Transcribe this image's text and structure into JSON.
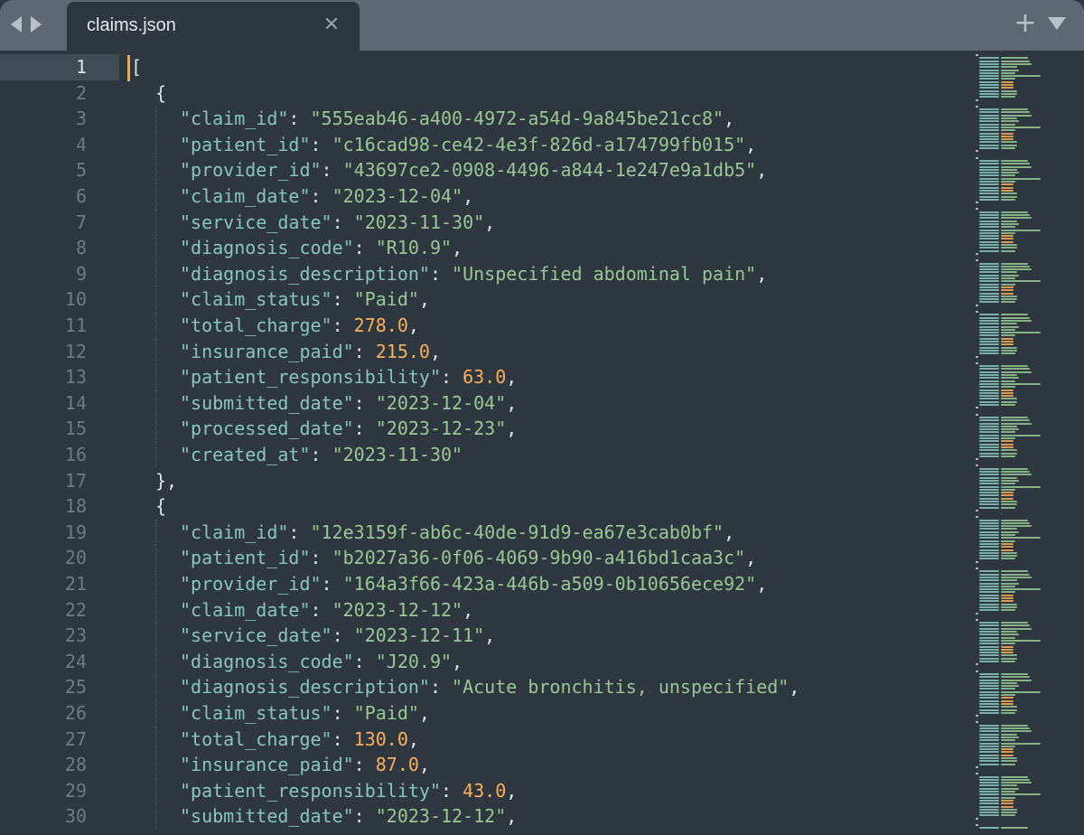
{
  "tab": {
    "title": "claims.json"
  },
  "icons": {
    "back": "triangle-left-icon",
    "forward": "triangle-right-icon",
    "close": "close-icon",
    "new_tab": "plus-icon",
    "tab_menu": "chevron-down-icon"
  },
  "colors": {
    "key": "#88c6bd",
    "string": "#99c794",
    "number": "#f9ae58",
    "punctuation": "#dfe3e7",
    "caret": "#f2a64d",
    "background": "#2e3640"
  },
  "close_glyph": "✕",
  "new_tab_glyph": "+",
  "editor": {
    "active_line": 1,
    "lines": [
      {
        "n": "1",
        "indent": 0,
        "parts": [
          {
            "t": "p",
            "v": "["
          }
        ]
      },
      {
        "n": "2",
        "indent": 1,
        "parts": [
          {
            "t": "p",
            "v": "{"
          }
        ]
      },
      {
        "n": "3",
        "indent": 2,
        "parts": [
          {
            "t": "k",
            "v": "\"claim_id\""
          },
          {
            "t": "p",
            "v": ": "
          },
          {
            "t": "s",
            "v": "\"555eab46-a400-4972-a54d-9a845be21cc8\""
          },
          {
            "t": "p",
            "v": ","
          }
        ]
      },
      {
        "n": "4",
        "indent": 2,
        "parts": [
          {
            "t": "k",
            "v": "\"patient_id\""
          },
          {
            "t": "p",
            "v": ": "
          },
          {
            "t": "s",
            "v": "\"c16cad98-ce42-4e3f-826d-a174799fb015\""
          },
          {
            "t": "p",
            "v": ","
          }
        ]
      },
      {
        "n": "5",
        "indent": 2,
        "parts": [
          {
            "t": "k",
            "v": "\"provider_id\""
          },
          {
            "t": "p",
            "v": ": "
          },
          {
            "t": "s",
            "v": "\"43697ce2-0908-4496-a844-1e247e9a1db5\""
          },
          {
            "t": "p",
            "v": ","
          }
        ]
      },
      {
        "n": "6",
        "indent": 2,
        "parts": [
          {
            "t": "k",
            "v": "\"claim_date\""
          },
          {
            "t": "p",
            "v": ": "
          },
          {
            "t": "s",
            "v": "\"2023-12-04\""
          },
          {
            "t": "p",
            "v": ","
          }
        ]
      },
      {
        "n": "7",
        "indent": 2,
        "parts": [
          {
            "t": "k",
            "v": "\"service_date\""
          },
          {
            "t": "p",
            "v": ": "
          },
          {
            "t": "s",
            "v": "\"2023-11-30\""
          },
          {
            "t": "p",
            "v": ","
          }
        ]
      },
      {
        "n": "8",
        "indent": 2,
        "parts": [
          {
            "t": "k",
            "v": "\"diagnosis_code\""
          },
          {
            "t": "p",
            "v": ": "
          },
          {
            "t": "s",
            "v": "\"R10.9\""
          },
          {
            "t": "p",
            "v": ","
          }
        ]
      },
      {
        "n": "9",
        "indent": 2,
        "parts": [
          {
            "t": "k",
            "v": "\"diagnosis_description\""
          },
          {
            "t": "p",
            "v": ": "
          },
          {
            "t": "s",
            "v": "\"Unspecified abdominal pain\""
          },
          {
            "t": "p",
            "v": ","
          }
        ]
      },
      {
        "n": "10",
        "indent": 2,
        "parts": [
          {
            "t": "k",
            "v": "\"claim_status\""
          },
          {
            "t": "p",
            "v": ": "
          },
          {
            "t": "s",
            "v": "\"Paid\""
          },
          {
            "t": "p",
            "v": ","
          }
        ]
      },
      {
        "n": "11",
        "indent": 2,
        "parts": [
          {
            "t": "k",
            "v": "\"total_charge\""
          },
          {
            "t": "p",
            "v": ": "
          },
          {
            "t": "n",
            "v": "278.0"
          },
          {
            "t": "p",
            "v": ","
          }
        ]
      },
      {
        "n": "12",
        "indent": 2,
        "parts": [
          {
            "t": "k",
            "v": "\"insurance_paid\""
          },
          {
            "t": "p",
            "v": ": "
          },
          {
            "t": "n",
            "v": "215.0"
          },
          {
            "t": "p",
            "v": ","
          }
        ]
      },
      {
        "n": "13",
        "indent": 2,
        "parts": [
          {
            "t": "k",
            "v": "\"patient_responsibility\""
          },
          {
            "t": "p",
            "v": ": "
          },
          {
            "t": "n",
            "v": "63.0"
          },
          {
            "t": "p",
            "v": ","
          }
        ]
      },
      {
        "n": "14",
        "indent": 2,
        "parts": [
          {
            "t": "k",
            "v": "\"submitted_date\""
          },
          {
            "t": "p",
            "v": ": "
          },
          {
            "t": "s",
            "v": "\"2023-12-04\""
          },
          {
            "t": "p",
            "v": ","
          }
        ]
      },
      {
        "n": "15",
        "indent": 2,
        "parts": [
          {
            "t": "k",
            "v": "\"processed_date\""
          },
          {
            "t": "p",
            "v": ": "
          },
          {
            "t": "s",
            "v": "\"2023-12-23\""
          },
          {
            "t": "p",
            "v": ","
          }
        ]
      },
      {
        "n": "16",
        "indent": 2,
        "parts": [
          {
            "t": "k",
            "v": "\"created_at\""
          },
          {
            "t": "p",
            "v": ": "
          },
          {
            "t": "s",
            "v": "\"2023-11-30\""
          }
        ]
      },
      {
        "n": "17",
        "indent": 1,
        "parts": [
          {
            "t": "p",
            "v": "},"
          }
        ]
      },
      {
        "n": "18",
        "indent": 1,
        "parts": [
          {
            "t": "p",
            "v": "{"
          }
        ]
      },
      {
        "n": "19",
        "indent": 2,
        "parts": [
          {
            "t": "k",
            "v": "\"claim_id\""
          },
          {
            "t": "p",
            "v": ": "
          },
          {
            "t": "s",
            "v": "\"12e3159f-ab6c-40de-91d9-ea67e3cab0bf\""
          },
          {
            "t": "p",
            "v": ","
          }
        ]
      },
      {
        "n": "20",
        "indent": 2,
        "parts": [
          {
            "t": "k",
            "v": "\"patient_id\""
          },
          {
            "t": "p",
            "v": ": "
          },
          {
            "t": "s",
            "v": "\"b2027a36-0f06-4069-9b90-a416bd1caa3c\""
          },
          {
            "t": "p",
            "v": ","
          }
        ]
      },
      {
        "n": "21",
        "indent": 2,
        "parts": [
          {
            "t": "k",
            "v": "\"provider_id\""
          },
          {
            "t": "p",
            "v": ": "
          },
          {
            "t": "s",
            "v": "\"164a3f66-423a-446b-a509-0b10656ece92\""
          },
          {
            "t": "p",
            "v": ","
          }
        ]
      },
      {
        "n": "22",
        "indent": 2,
        "parts": [
          {
            "t": "k",
            "v": "\"claim_date\""
          },
          {
            "t": "p",
            "v": ": "
          },
          {
            "t": "s",
            "v": "\"2023-12-12\""
          },
          {
            "t": "p",
            "v": ","
          }
        ]
      },
      {
        "n": "23",
        "indent": 2,
        "parts": [
          {
            "t": "k",
            "v": "\"service_date\""
          },
          {
            "t": "p",
            "v": ": "
          },
          {
            "t": "s",
            "v": "\"2023-12-11\""
          },
          {
            "t": "p",
            "v": ","
          }
        ]
      },
      {
        "n": "24",
        "indent": 2,
        "parts": [
          {
            "t": "k",
            "v": "\"diagnosis_code\""
          },
          {
            "t": "p",
            "v": ": "
          },
          {
            "t": "s",
            "v": "\"J20.9\""
          },
          {
            "t": "p",
            "v": ","
          }
        ]
      },
      {
        "n": "25",
        "indent": 2,
        "parts": [
          {
            "t": "k",
            "v": "\"diagnosis_description\""
          },
          {
            "t": "p",
            "v": ": "
          },
          {
            "t": "s",
            "v": "\"Acute bronchitis, unspecified\""
          },
          {
            "t": "p",
            "v": ","
          }
        ]
      },
      {
        "n": "26",
        "indent": 2,
        "parts": [
          {
            "t": "k",
            "v": "\"claim_status\""
          },
          {
            "t": "p",
            "v": ": "
          },
          {
            "t": "s",
            "v": "\"Paid\""
          },
          {
            "t": "p",
            "v": ","
          }
        ]
      },
      {
        "n": "27",
        "indent": 2,
        "parts": [
          {
            "t": "k",
            "v": "\"total_charge\""
          },
          {
            "t": "p",
            "v": ": "
          },
          {
            "t": "n",
            "v": "130.0"
          },
          {
            "t": "p",
            "v": ","
          }
        ]
      },
      {
        "n": "28",
        "indent": 2,
        "parts": [
          {
            "t": "k",
            "v": "\"insurance_paid\""
          },
          {
            "t": "p",
            "v": ": "
          },
          {
            "t": "n",
            "v": "87.0"
          },
          {
            "t": "p",
            "v": ","
          }
        ]
      },
      {
        "n": "29",
        "indent": 2,
        "parts": [
          {
            "t": "k",
            "v": "\"patient_responsibility\""
          },
          {
            "t": "p",
            "v": ": "
          },
          {
            "t": "n",
            "v": "43.0"
          },
          {
            "t": "p",
            "v": ","
          }
        ]
      },
      {
        "n": "30",
        "indent": 2,
        "parts": [
          {
            "t": "k",
            "v": "\"submitted_date\""
          },
          {
            "t": "p",
            "v": ": "
          },
          {
            "t": "s",
            "v": "\"2023-12-12\""
          },
          {
            "t": "p",
            "v": ","
          }
        ]
      }
    ]
  }
}
